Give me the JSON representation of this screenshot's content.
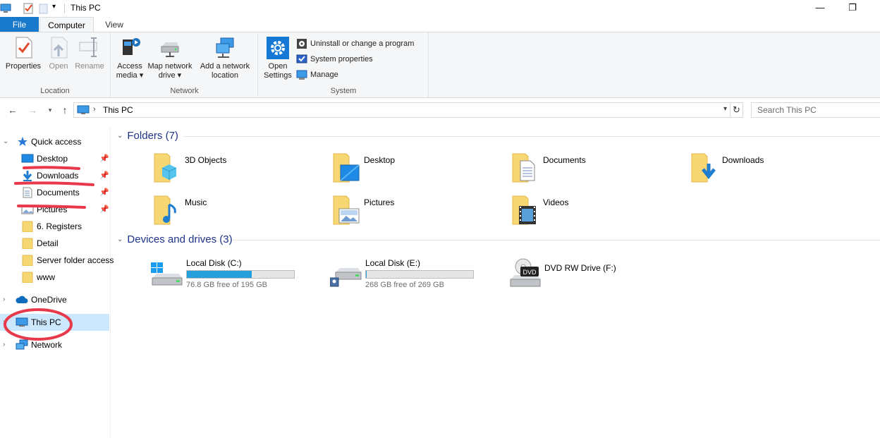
{
  "window": {
    "title": "This PC"
  },
  "ribbon": {
    "tabs": {
      "file": "File",
      "computer": "Computer",
      "view": "View"
    },
    "location": {
      "label": "Location",
      "properties": "Properties",
      "open": "Open",
      "rename": "Rename"
    },
    "network": {
      "label": "Network",
      "access_media_1": "Access",
      "access_media_2": "media ▾",
      "map_drive_1": "Map network",
      "map_drive_2": "drive ▾",
      "add_location_1": "Add a network",
      "add_location_2": "location"
    },
    "system": {
      "label": "System",
      "open_settings_1": "Open",
      "open_settings_2": "Settings",
      "uninstall": "Uninstall or change a program",
      "system_properties": "System properties",
      "manage": "Manage"
    }
  },
  "address": {
    "crumb": "This PC",
    "search_placeholder": "Search This PC"
  },
  "navpane": {
    "quick_access": "Quick access",
    "items": [
      {
        "label": "Desktop"
      },
      {
        "label": "Downloads"
      },
      {
        "label": "Documents"
      },
      {
        "label": "Pictures"
      },
      {
        "label": "6. Registers"
      },
      {
        "label": "Detail"
      },
      {
        "label": "Server folder access"
      },
      {
        "label": "www"
      }
    ],
    "onedrive": "OneDrive",
    "thispc": "This PC",
    "network": "Network"
  },
  "content": {
    "folders_header": "Folders (7)",
    "folders": [
      {
        "name": "3D Objects"
      },
      {
        "name": "Desktop"
      },
      {
        "name": "Documents"
      },
      {
        "name": "Downloads"
      },
      {
        "name": "Music"
      },
      {
        "name": "Pictures"
      },
      {
        "name": "Videos"
      }
    ],
    "drives_header": "Devices and drives (3)",
    "drives": [
      {
        "name": "Local Disk (C:)",
        "free": "76.8 GB free of 195 GB",
        "used_fraction": 0.606
      },
      {
        "name": "Local Disk (E:)",
        "free": "268 GB free of 269 GB",
        "used_fraction": 0.004
      },
      {
        "name": "DVD RW Drive (F:)",
        "disc_label": "DVD"
      }
    ]
  },
  "colors": {
    "accent": "#1979ca",
    "selection": "#cce8ff",
    "annotation": "#e8394a",
    "header": "#1e3287"
  }
}
